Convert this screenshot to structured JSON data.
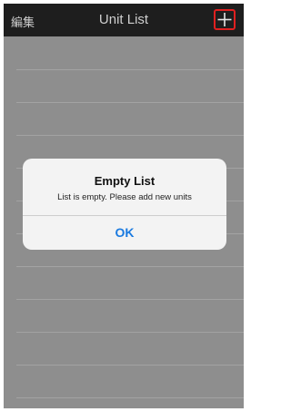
{
  "navbar": {
    "edit_label": "編集",
    "title": "Unit List",
    "add_icon": "plus-icon",
    "add_highlight_color": "#e02020"
  },
  "alert": {
    "title": "Empty List",
    "message": "List is empty. Please add new units",
    "ok_label": "OK",
    "ok_color": "#1a7ae0"
  }
}
